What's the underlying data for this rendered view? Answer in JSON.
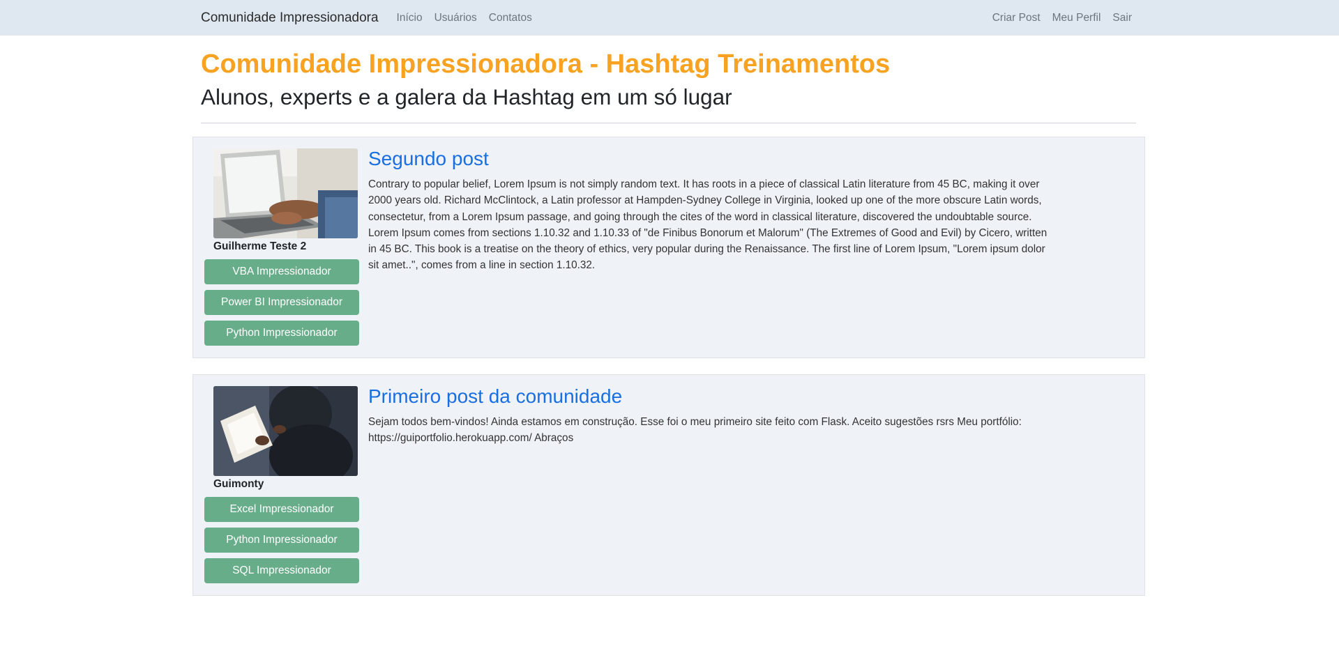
{
  "navbar": {
    "brand": "Comunidade Impressionadora",
    "left_links": [
      "Início",
      "Usuários",
      "Contatos"
    ],
    "right_links": [
      "Criar Post",
      "Meu Perfil",
      "Sair"
    ]
  },
  "header": {
    "title": "Comunidade Impressionadora - Hashtag Treinamentos",
    "subtitle": "Alunos, experts e a galera da Hashtag em um só lugar"
  },
  "posts": [
    {
      "title": "Segundo post",
      "author": "Guilherme Teste 2",
      "tags": [
        "VBA Impressionador",
        "Power BI Impressionador",
        "Python Impressionador"
      ],
      "body": "Contrary to popular belief, Lorem Ipsum is not simply random text. It has roots in a piece of classical Latin literature from 45 BC, making it over 2000 years old. Richard McClintock, a Latin professor at Hampden-Sydney College in Virginia, looked up one of the more obscure Latin words, consectetur, from a Lorem Ipsum passage, and going through the cites of the word in classical literature, discovered the undoubtable source. Lorem Ipsum comes from sections 1.10.32 and 1.10.33 of \"de Finibus Bonorum et Malorum\" (The Extremes of Good and Evil) by Cicero, written in 45 BC. This book is a treatise on the theory of ethics, very popular during the Renaissance. The first line of Lorem Ipsum, \"Lorem ipsum dolor sit amet..\", comes from a line in section 1.10.32."
    },
    {
      "title": "Primeiro post da comunidade",
      "author": "Guimonty",
      "tags": [
        "Excel Impressionador",
        "Python Impressionador",
        "SQL Impressionador"
      ],
      "body": "Sejam todos bem-vindos! Ainda estamos em construção. Esse foi o meu primeiro site feito com Flask. Aceito sugestões rsrs Meu portfólio: https://guiportfolio.herokuapp.com/ Abraços"
    }
  ],
  "colors": {
    "navbar_bg": "#dfe7f1",
    "title_orange": "#f7a221",
    "link_blue": "#1a6fe0",
    "tag_green": "#68ad8a",
    "card_bg": "#eff2f6"
  }
}
